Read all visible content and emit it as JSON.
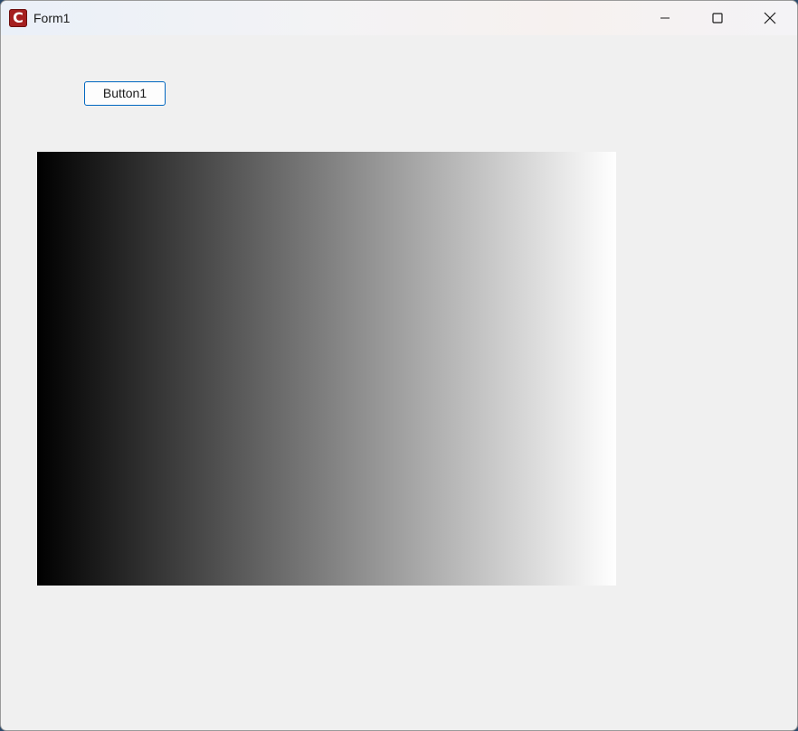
{
  "window": {
    "title": "Form1",
    "icon": "c-app-icon",
    "icon_glyph": "C",
    "icon_color": "#a51f1f"
  },
  "caption_buttons": {
    "minimize": "minimize-icon",
    "maximize": "maximize-icon",
    "close": "close-icon"
  },
  "form": {
    "button_label": "Button1",
    "button_border_color": "#0067c0",
    "gradient": {
      "from_color": "#000000",
      "to_color": "#ffffff",
      "direction": "left-to-right"
    }
  }
}
